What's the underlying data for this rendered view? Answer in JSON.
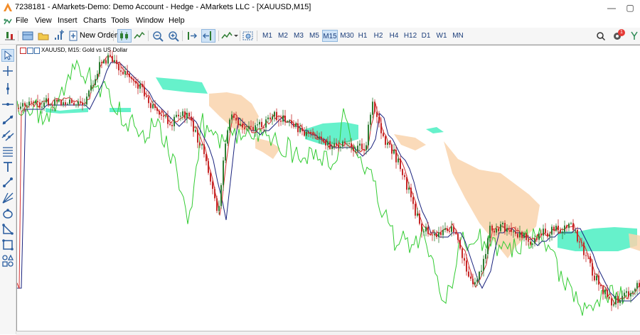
{
  "window": {
    "title": "7238181 - AMarkets-Demo: Demo Account - Hedge - AMarkets LLC - [XAUUSD,M15]"
  },
  "menu": [
    "File",
    "View",
    "Insert",
    "Charts",
    "Tools",
    "Window",
    "Help"
  ],
  "toolbar": {
    "new_order_label": "New Order",
    "timeframes": [
      "M1",
      "M2",
      "M3",
      "M5",
      "M15",
      "M30",
      "H1",
      "H2",
      "H4",
      "H12",
      "D1",
      "W1",
      "MN"
    ],
    "active_timeframe": "M15",
    "notification_count": "1"
  },
  "chart": {
    "symbol_label": "XAUUSD, M15:  Gold vs US Dollar",
    "colors": {
      "bull_candle": "#2e7d32",
      "bear_candle": "#c62828",
      "tenkan": "#d32f2f",
      "kijun": "#1a237e",
      "chikou": "#33cc33",
      "kumo_bull": "#5ef0c8",
      "kumo_bear": "#f9d3ad"
    },
    "indicators": [
      "Ichimoku Kinko Hyo"
    ],
    "grid": false
  },
  "left_toolbar": [
    "cursor-icon",
    "crosshair-icon",
    "vertical-line-icon",
    "horizontal-line-icon",
    "trendline-icon",
    "channel-icon",
    "fibonacci-icon",
    "text-icon",
    "arrow-icon",
    "gann-icon",
    "shapes-icon",
    "triangle-icon",
    "rectangle-icon",
    "more-tools-icon"
  ]
}
